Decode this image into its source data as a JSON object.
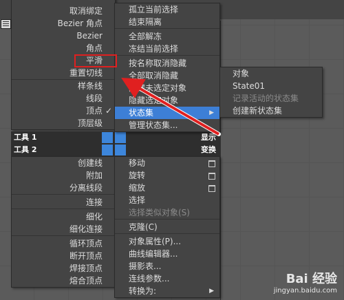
{
  "left_menu": {
    "items": [
      {
        "label": "取消绑定",
        "dim": false
      },
      {
        "label": "Bezier 角点",
        "dim": false
      },
      {
        "label": "Bezier",
        "dim": false
      },
      {
        "label": "角点",
        "dim": false
      },
      {
        "label": "平滑",
        "dim": false
      },
      {
        "label": "重置切线",
        "dim": false
      },
      {
        "label": "样条线",
        "dim": false
      },
      {
        "label": "线段",
        "dim": false
      },
      {
        "label": "顶点",
        "dim": false,
        "checked": true
      },
      {
        "label": "顶层级",
        "dim": false
      }
    ],
    "check_glyph": "✓",
    "tools": [
      {
        "label": "创建线"
      },
      {
        "label": "附加"
      },
      {
        "label": "分离线段"
      },
      {
        "label": "连接"
      },
      {
        "label": "细化"
      },
      {
        "label": "细化连接"
      },
      {
        "label": "循环顶点"
      },
      {
        "label": "断开顶点"
      },
      {
        "label": "焊接顶点"
      },
      {
        "label": "熔合顶点"
      }
    ]
  },
  "center_menu": {
    "top_items": [
      {
        "label": "孤立当前选择"
      },
      {
        "label": "结束隔离"
      },
      {
        "label": "全部解冻"
      },
      {
        "label": "冻结当前选择"
      },
      {
        "label": "按名称取消隐藏"
      },
      {
        "label": "全部取消隐藏"
      },
      {
        "label": "隐藏未选定对象"
      },
      {
        "label": "隐藏选定对象"
      },
      {
        "label": "状态集"
      },
      {
        "label": "管理状态集..."
      }
    ],
    "bottom_items": [
      {
        "label": "移动"
      },
      {
        "label": "旋转"
      },
      {
        "label": "缩放"
      },
      {
        "label": "选择"
      },
      {
        "label": "选择类似对象(S)"
      },
      {
        "label": "克隆(C)"
      },
      {
        "label": "对象属性(P)..."
      },
      {
        "label": "曲线编辑器..."
      },
      {
        "label": "摄影表..."
      },
      {
        "label": "连线参数..."
      },
      {
        "label": "转换为:"
      }
    ]
  },
  "quad_bars": {
    "tools1": "工具 1",
    "tools2": "工具 2",
    "display": "显示",
    "transform": "变换"
  },
  "submenu": {
    "items": [
      {
        "label": "对象",
        "dim": false
      },
      {
        "label": "State01",
        "dim": false
      },
      {
        "label": "记录活动的状态集",
        "dim": true
      },
      {
        "label": "创建新状态集",
        "dim": false
      }
    ]
  },
  "watermark": {
    "brand": "Bai 经验",
    "url": "jingyan.baidu.com"
  },
  "colors": {
    "highlight": "#3d7fd6",
    "annotation_red": "#e02020",
    "menu_bg": "#444444"
  }
}
